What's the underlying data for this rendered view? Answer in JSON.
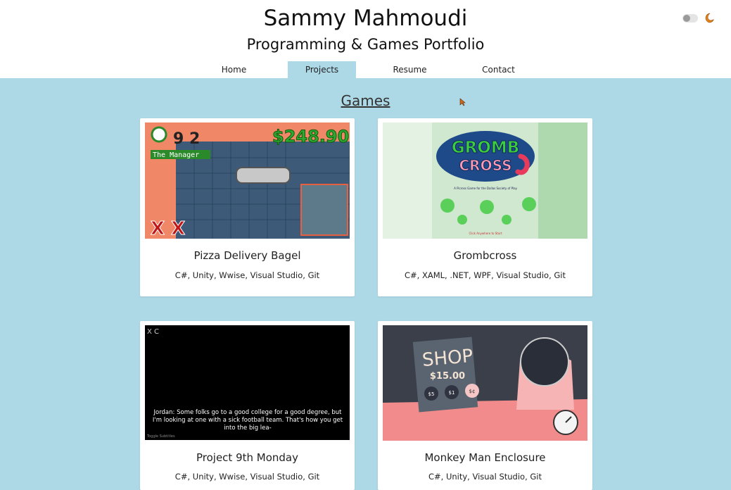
{
  "header": {
    "title": "Sammy Mahmoudi",
    "subtitle": "Programming & Games Portfolio",
    "nav": [
      {
        "label": "Home",
        "active": false
      },
      {
        "label": "Projects",
        "active": true
      },
      {
        "label": "Resume",
        "active": false
      },
      {
        "label": "Contact",
        "active": false
      }
    ],
    "theme_toggle": {
      "state": "off",
      "icon": "moon-icon"
    }
  },
  "main": {
    "section_title": "Games",
    "projects": [
      {
        "title": "Pizza Delivery Bagel",
        "tech": "C#, Unity, Wwise, Visual Studio, Git",
        "thumb": {
          "timer": "9 2",
          "money": "$248.90",
          "banner": "The Manager",
          "marks": "X X",
          "bg_color": "#f08868",
          "floor_color": "#3d5a78"
        }
      },
      {
        "title": "Grombcross",
        "tech": "C#, XAML, .NET, WPF, Visual Studio, Git",
        "thumb": {
          "logo_top": "GROMB",
          "logo_bottom": "CROSS",
          "tagline": "A Picross Game for the Dallas Society of Play",
          "prompt": "Click Anywhere to Start",
          "bg_color": "#cfe8cf"
        }
      },
      {
        "title": "Project 9th Monday",
        "tech": "C#, Unity, Wwise, Visual Studio, Git",
        "thumb": {
          "corner_label": "X C",
          "subtitle_lines": [
            "Jordan: Some folks go to a good college for a good degree, but",
            "I'm looking at one with a sick football team. That's how you get",
            "into the big lea-"
          ],
          "toggle_label": "Toggle Subtitles",
          "bg_color": "#000000"
        }
      },
      {
        "title": "Monkey Man Enclosure",
        "tech": "C#, Unity, Visual Studio, Git",
        "thumb": {
          "shop_title": "SHOP",
          "price": "$15.00",
          "coin_labels": [
            "$5",
            "$1",
            "$¢"
          ],
          "bg_color": "#3a3f4a",
          "accent_color": "#f28c8c"
        }
      }
    ]
  }
}
